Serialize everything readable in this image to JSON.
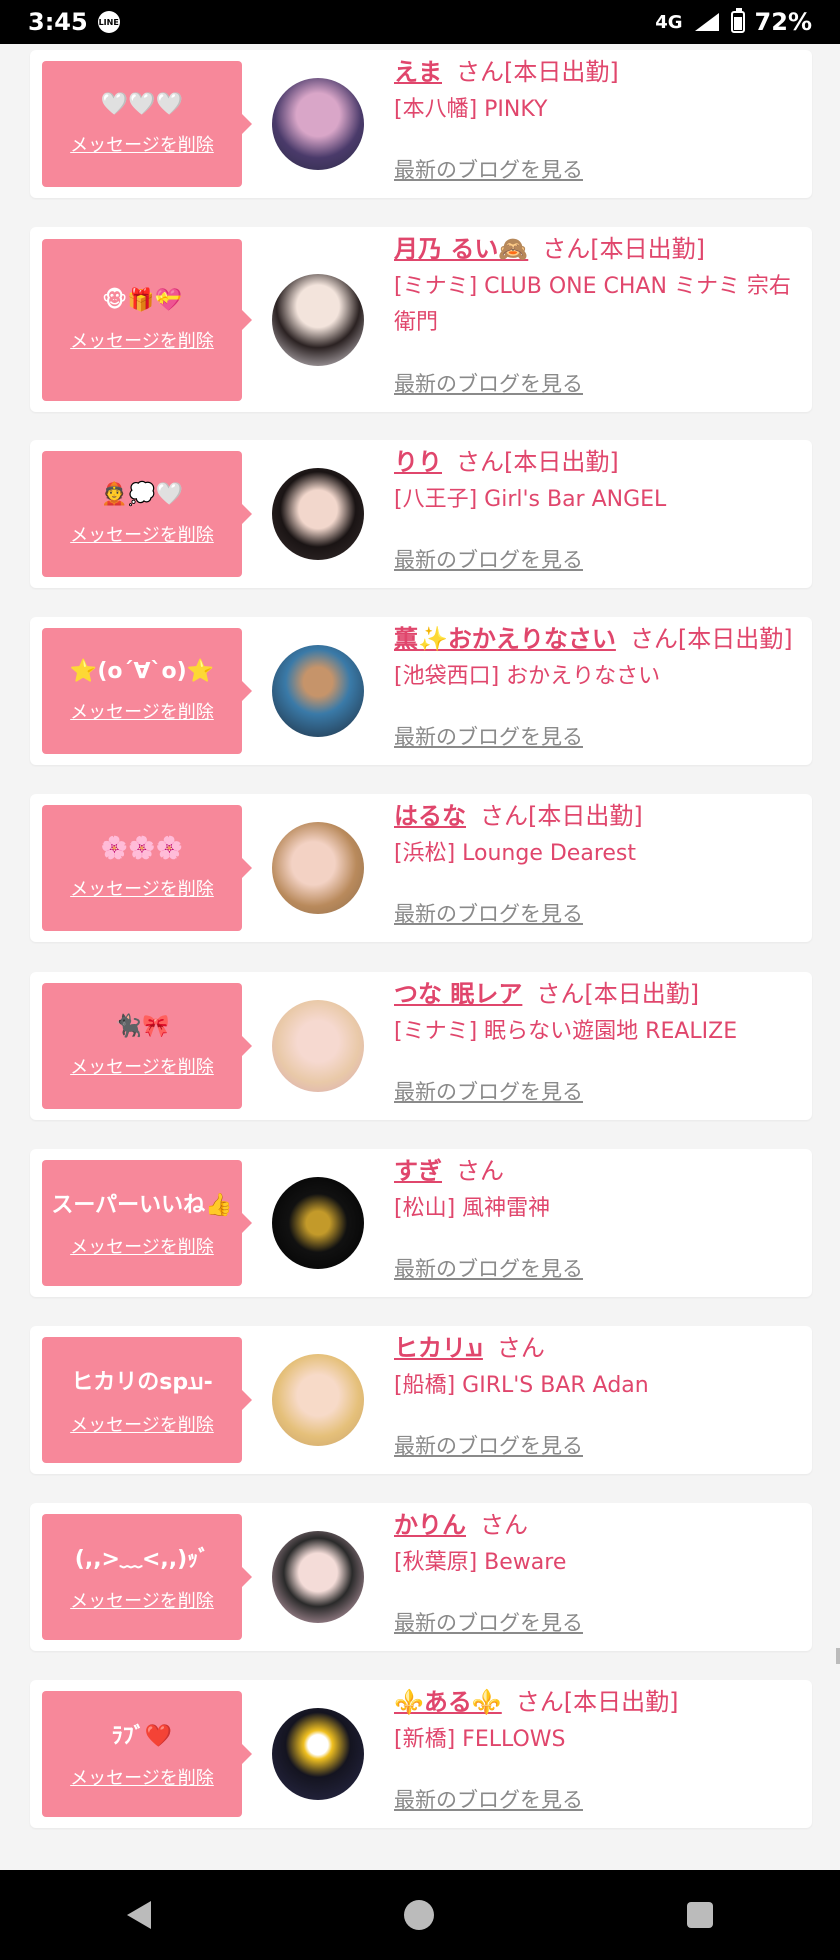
{
  "status_bar": {
    "time": "3:45",
    "line_badge": "LINE",
    "network": "4G",
    "battery": "72%",
    "battery_level": 0.72
  },
  "delete_label": "メッセージを削除",
  "blog_label": "最新のブログを見る",
  "cards": [
    {
      "message": "🤍🤍🤍",
      "name": "えま",
      "suffix": "さん[本日出勤]",
      "shop": "[本八幡] PINKY"
    },
    {
      "message": "🐵🎁💝",
      "name": "月乃 るい🙈",
      "suffix": "さん[本日出勤]",
      "shop": "[ミナミ] CLUB ONE CHAN ミナミ 宗右衛門"
    },
    {
      "message": "👲💭🤍",
      "name": "りり",
      "suffix": "さん[本日出勤]",
      "shop": "[八王子] Girl's Bar ANGEL"
    },
    {
      "message": "⭐(o´∀`o)⭐",
      "name": "薫✨おかえりなさい",
      "suffix": "さん[本日出勤]",
      "shop": "[池袋西口] おかえりなさい"
    },
    {
      "message": "🌸🌸🌸",
      "name": "はるな",
      "suffix": "さん[本日出勤]",
      "shop": "[浜松] Lounge Dearest"
    },
    {
      "message": "🐈‍⬛🎀",
      "name": "つな 眠レア",
      "suffix": "さん[本日出勤]",
      "shop": "[ミナミ] 眠らない遊園地 REALIZE"
    },
    {
      "message": "スーパーいいね👍",
      "name": "すぎ",
      "suffix": "さん",
      "shop": "[松山] 風神雷神"
    },
    {
      "message": "ヒカリのsp𐭠-",
      "name": "ヒカリ𐭠",
      "suffix": "さん",
      "shop": "[船橋] GIRL'S BAR Adan"
    },
    {
      "message": "(,,>﹏<,,)ｯﾞ",
      "name": "かりん",
      "suffix": "さん",
      "shop": "[秋葉原] Beware"
    },
    {
      "message": "ﾗﾌﾞ❤️",
      "name": "⚜️ある⚜️",
      "suffix": "さん[本日出勤]",
      "shop": "[新橋] FELLOWS"
    }
  ],
  "colors": {
    "accent": "#e0466c",
    "bubble": "#f7889a",
    "blog_link": "#8a8a8a"
  },
  "icons": {
    "back": "back-icon",
    "home": "home-icon",
    "recents": "recents-icon"
  }
}
